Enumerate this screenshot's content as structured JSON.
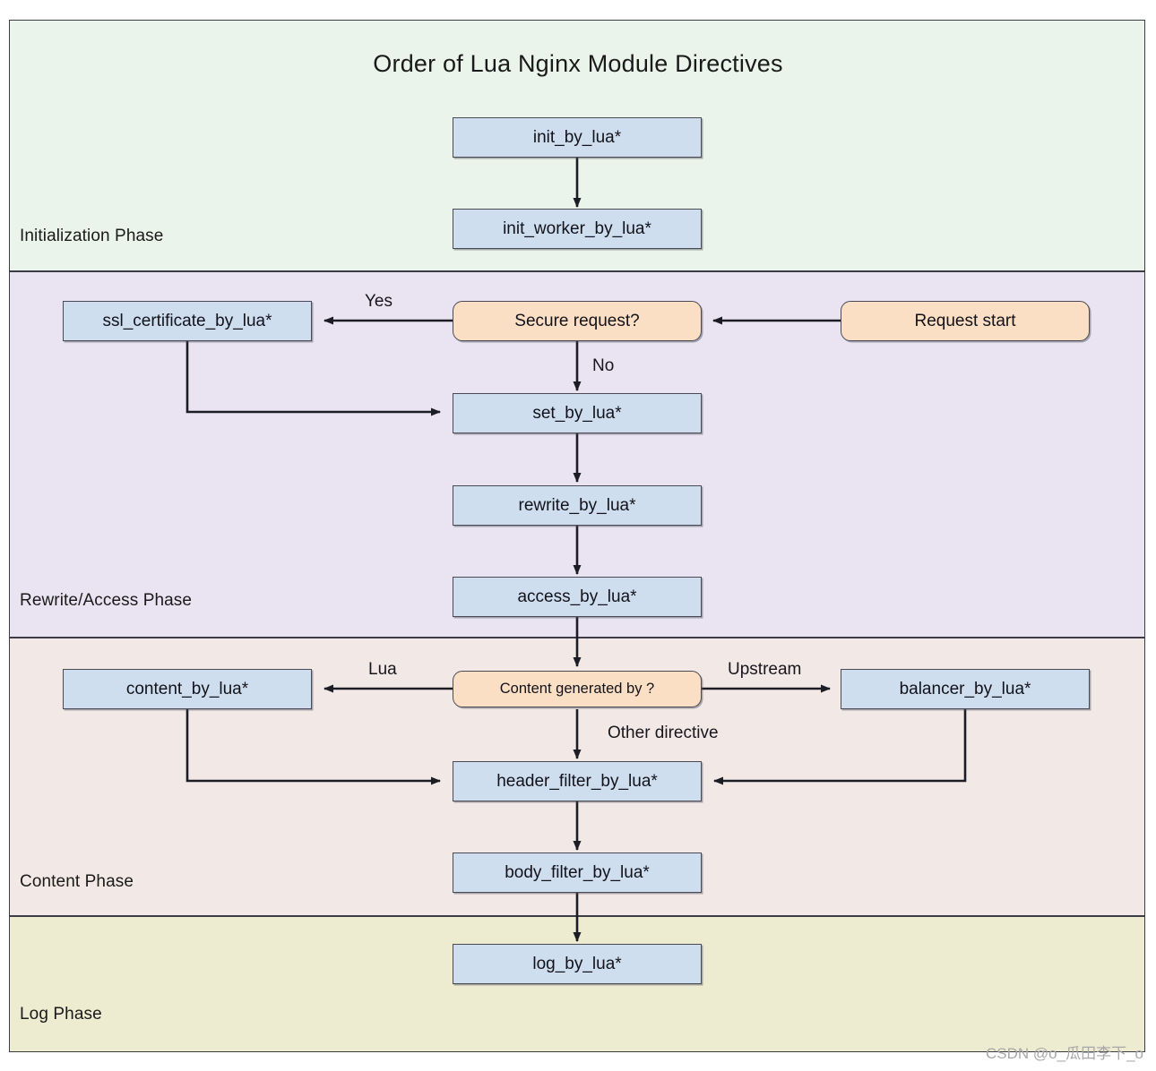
{
  "title": "Order of Lua Nginx Module Directives",
  "bands": [
    {
      "id": "init",
      "label": "Initialization Phase",
      "color": "#eaf4ea"
    },
    {
      "id": "rewrite",
      "label": "Rewrite/Access Phase",
      "color": "#eae4f2"
    },
    {
      "id": "content",
      "label": "Content Phase",
      "color": "#f2e9e7"
    },
    {
      "id": "log",
      "label": "Log Phase",
      "color": "#edecd1"
    }
  ],
  "nodes": {
    "init_by_lua": "init_by_lua*",
    "init_worker_by_lua": "init_worker_by_lua*",
    "ssl_certificate_by_lua": "ssl_certificate_by_lua*",
    "secure_request": "Secure request?",
    "request_start": "Request start",
    "set_by_lua": "set_by_lua*",
    "rewrite_by_lua": "rewrite_by_lua*",
    "access_by_lua": "access_by_lua*",
    "content_by_lua": "content_by_lua*",
    "content_generated_by": "Content generated by ?",
    "balancer_by_lua": "balancer_by_lua*",
    "header_filter_by_lua": "header_filter_by_lua*",
    "body_filter_by_lua": "body_filter_by_lua*",
    "log_by_lua": "log_by_lua*"
  },
  "edge_labels": {
    "yes": "Yes",
    "no": "No",
    "lua": "Lua",
    "upstream": "Upstream",
    "other_directive": "Other directive"
  },
  "watermark": "CSDN @o_瓜田李下_o",
  "colors": {
    "process_fill": "#cfdeef",
    "terminator_fill": "#fadfc5",
    "node_stroke": "#4a4a54",
    "edge_stroke": "#1c1c24",
    "band_init": "#eaf4ea",
    "band_rewrite": "#eae4f2",
    "band_content": "#f2e9e7",
    "band_log": "#edecd1",
    "watermark": "#a8a8a8"
  },
  "chart_data": {
    "type": "flowchart",
    "title": "Order of Lua Nginx Module Directives",
    "lanes": [
      {
        "name": "Initialization Phase",
        "nodes": [
          "init_by_lua*",
          "init_worker_by_lua*"
        ]
      },
      {
        "name": "Rewrite/Access Phase",
        "nodes": [
          "Request start",
          "Secure request?",
          "ssl_certificate_by_lua*",
          "set_by_lua*",
          "rewrite_by_lua*",
          "access_by_lua*"
        ]
      },
      {
        "name": "Content Phase",
        "nodes": [
          "Content generated by ?",
          "content_by_lua*",
          "balancer_by_lua*",
          "header_filter_by_lua*",
          "body_filter_by_lua*"
        ]
      },
      {
        "name": "Log Phase",
        "nodes": [
          "log_by_lua*"
        ]
      }
    ],
    "edges": [
      {
        "from": "init_by_lua*",
        "to": "init_worker_by_lua*",
        "label": ""
      },
      {
        "from": "Request start",
        "to": "Secure request?",
        "label": ""
      },
      {
        "from": "Secure request?",
        "to": "ssl_certificate_by_lua*",
        "label": "Yes"
      },
      {
        "from": "Secure request?",
        "to": "set_by_lua*",
        "label": "No"
      },
      {
        "from": "ssl_certificate_by_lua*",
        "to": "set_by_lua*",
        "label": ""
      },
      {
        "from": "set_by_lua*",
        "to": "rewrite_by_lua*",
        "label": ""
      },
      {
        "from": "rewrite_by_lua*",
        "to": "access_by_lua*",
        "label": ""
      },
      {
        "from": "access_by_lua*",
        "to": "Content generated by ?",
        "label": ""
      },
      {
        "from": "Content generated by ?",
        "to": "content_by_lua*",
        "label": "Lua"
      },
      {
        "from": "Content generated by ?",
        "to": "balancer_by_lua*",
        "label": "Upstream"
      },
      {
        "from": "Content generated by ?",
        "to": "header_filter_by_lua*",
        "label": "Other directive"
      },
      {
        "from": "content_by_lua*",
        "to": "header_filter_by_lua*",
        "label": ""
      },
      {
        "from": "balancer_by_lua*",
        "to": "header_filter_by_lua*",
        "label": ""
      },
      {
        "from": "header_filter_by_lua*",
        "to": "body_filter_by_lua*",
        "label": ""
      },
      {
        "from": "body_filter_by_lua*",
        "to": "log_by_lua*",
        "label": ""
      }
    ]
  }
}
